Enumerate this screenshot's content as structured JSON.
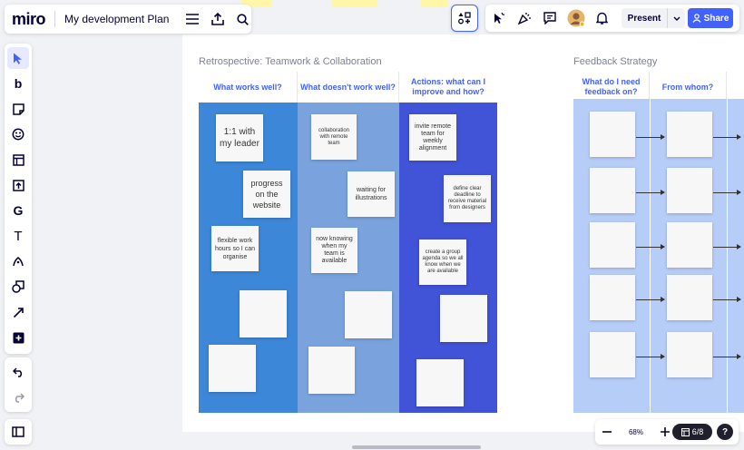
{
  "app": {
    "logo": "miro",
    "board_title": "My development Plan"
  },
  "toolbar_right": {
    "present_label": "Present",
    "share_label": "Share"
  },
  "zoom": {
    "level": "68%",
    "pages": "6/8",
    "help": "?"
  },
  "left_tools": [
    {
      "name": "select-tool",
      "glyph": ""
    },
    {
      "name": "templates-tool",
      "glyph": "b"
    },
    {
      "name": "sticky-note-tool",
      "glyph": ""
    },
    {
      "name": "stickers-tool",
      "glyph": ""
    },
    {
      "name": "frames-tool",
      "glyph": ""
    },
    {
      "name": "upload-tool",
      "glyph": ""
    },
    {
      "name": "google-drive-tool",
      "glyph": "G"
    },
    {
      "name": "text-tool",
      "glyph": "T"
    },
    {
      "name": "pen-tool",
      "glyph": ""
    },
    {
      "name": "shapes-tool",
      "glyph": ""
    },
    {
      "name": "connection-line-tool",
      "glyph": ""
    },
    {
      "name": "more-apps-tool",
      "glyph": ""
    }
  ],
  "retro": {
    "title": "Retrospective: Teamwork & Collaboration",
    "columns": [
      {
        "heading": "What works well?",
        "color": "#3d87d8"
      },
      {
        "heading": "What doesn't work well?",
        "color": "#7aa3de"
      },
      {
        "heading": "Actions: what can I improve and how?",
        "color": "#4153d6"
      }
    ],
    "notes": {
      "n1": "1:1 with my leader",
      "n2": "progress on the website",
      "n3": "flexible work hours so I can organise",
      "n4": "collaboration with remote team",
      "n5": "waiting for illustrations",
      "n6": "now knowing when my team is available",
      "n7": "invite remote team for weekly alignment",
      "n8": "define clear deadline to receive material from designers",
      "n9": "create a group agenda so we all know when we are available"
    }
  },
  "feedback": {
    "title": "Feedback Strategy",
    "columns": [
      {
        "heading": "What do I need feedback on?"
      },
      {
        "heading": "From whom?"
      }
    ],
    "color": "#b6cdf7"
  }
}
